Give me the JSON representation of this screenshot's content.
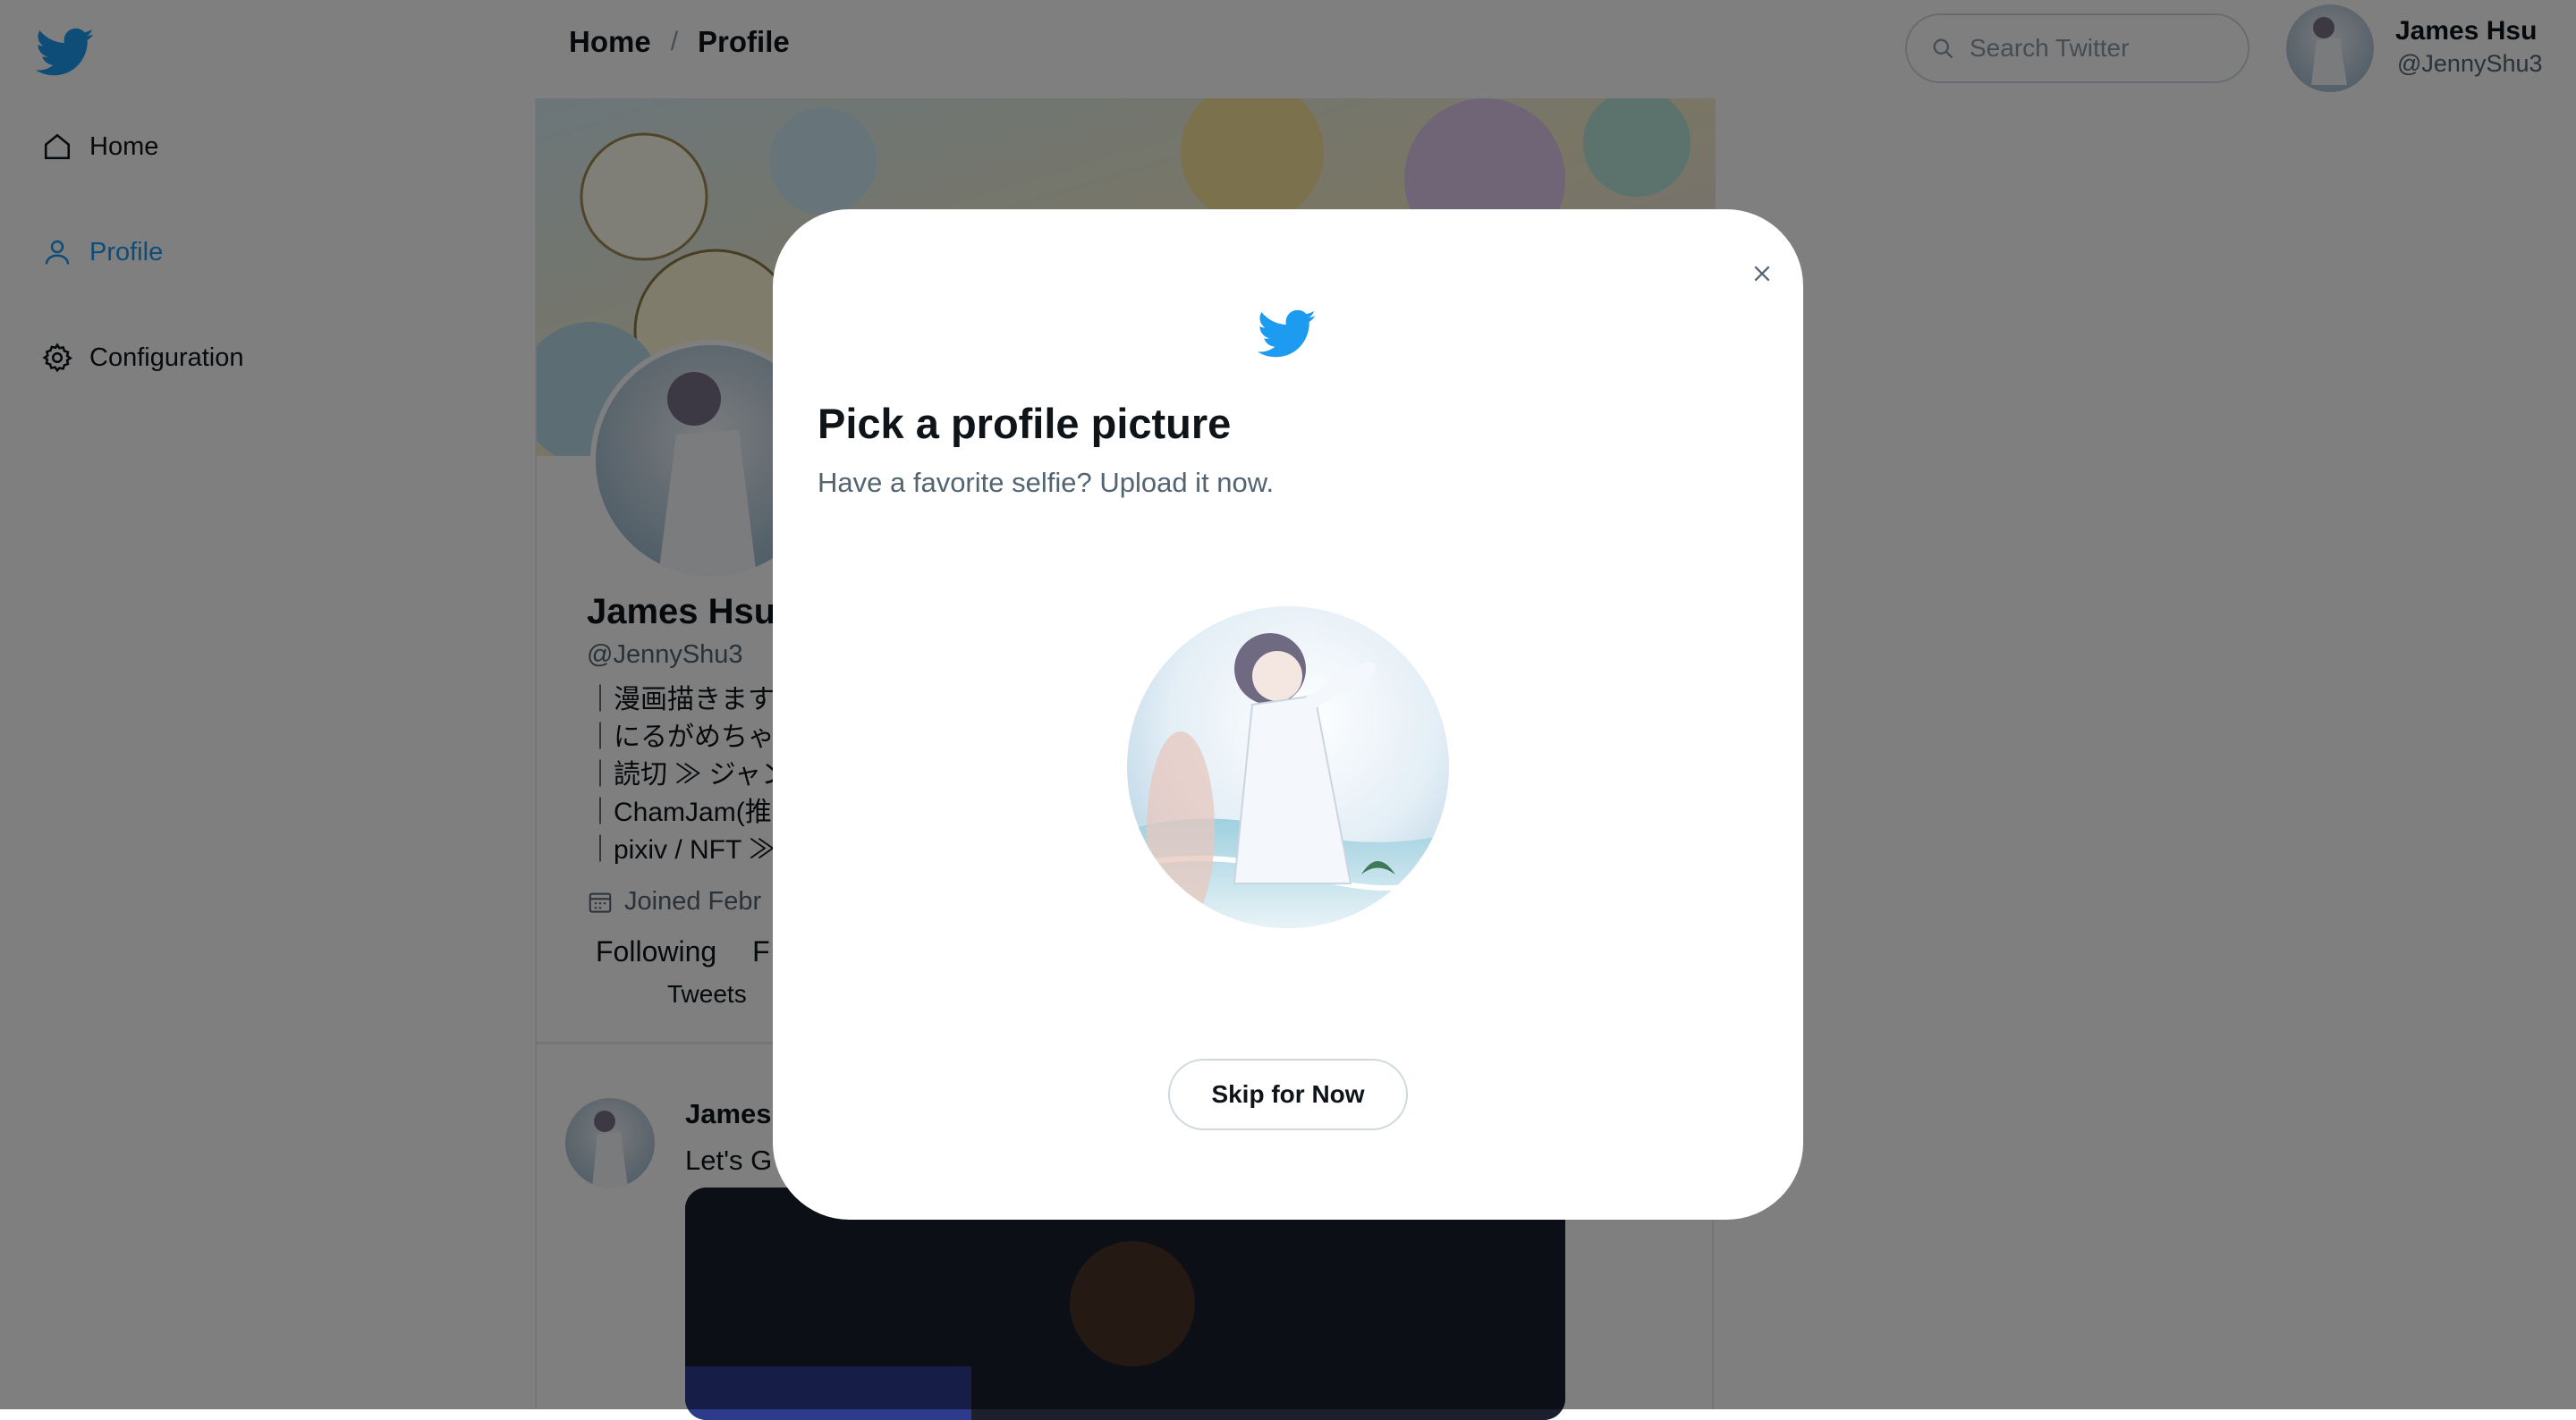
{
  "nav": {
    "items": [
      {
        "label": "Home",
        "icon": "home-icon"
      },
      {
        "label": "Profile",
        "icon": "user-icon"
      },
      {
        "label": "Configuration",
        "icon": "gear-icon"
      }
    ]
  },
  "header": {
    "breadcrumb": [
      "Home",
      "/",
      "Profile"
    ],
    "search_placeholder": "Search Twitter",
    "user_name": "James Hsu",
    "user_handle": "@JennyShu3"
  },
  "profile": {
    "name": "James Hsu",
    "handle": "@JennyShu3",
    "bio": [
      "｜漫画描きます",
      "｜にるがめちゃ",
      "｜読切 ≫ ジャン",
      "｜ChamJam(推",
      "｜pixiv / NFT ≫"
    ],
    "joined": "Joined Febr",
    "following_label": "Following",
    "followers_label": "F",
    "tabs": [
      "Tweets"
    ]
  },
  "tweet": {
    "author": "James",
    "text": "Let's G"
  },
  "modal": {
    "title": "Pick a profile picture",
    "subtitle": "Have a favorite selfie? Upload it now.",
    "skip_label": "Skip for Now"
  },
  "colors": {
    "brand": "#1d9bf0",
    "text": "#0f1419",
    "muted": "#536471",
    "border": "#cfd9de",
    "overlay": "rgba(0,0,0,0.5)"
  }
}
